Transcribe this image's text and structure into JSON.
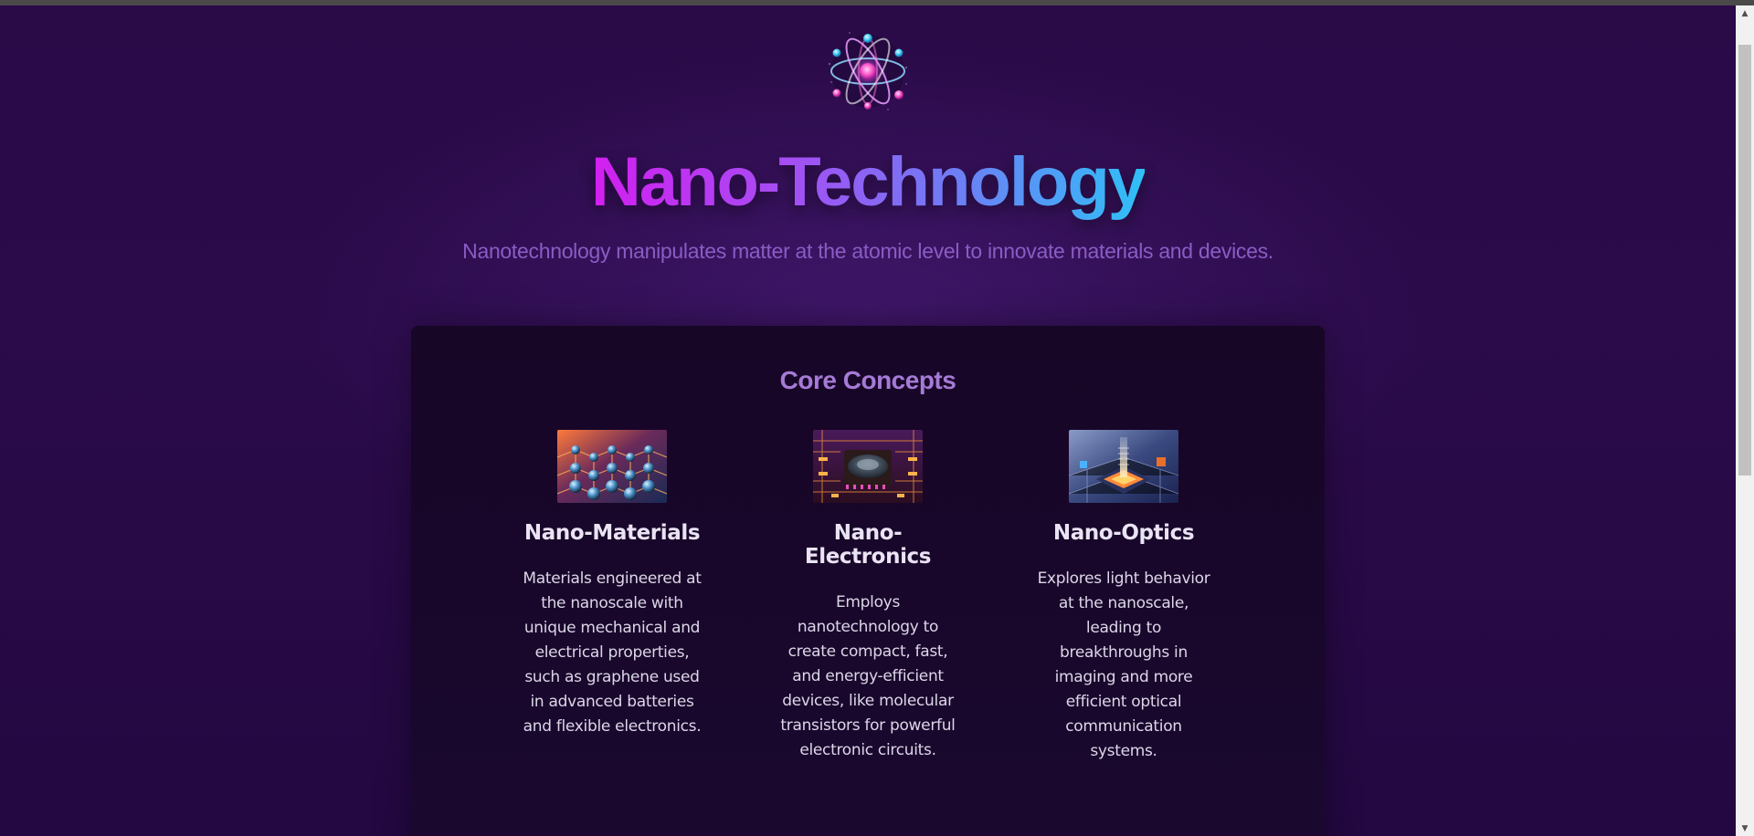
{
  "hero": {
    "title": "Nano-Technology",
    "subtitle": "Nanotechnology manipulates matter at the atomic level to innovate materials and devices."
  },
  "logo": {
    "icon": "atom-icon"
  },
  "core_concepts": {
    "title": "Core Concepts",
    "items": [
      {
        "title": "Nano-Materials",
        "image": "nano-materials-image",
        "text": "Materials engineered at the nanoscale with unique mechanical and electrical properties, such as graphene used in advanced batteries and flexible electronics."
      },
      {
        "title": "Nano-Electronics",
        "image": "nano-electronics-image",
        "text": "Employs nanotechnology to create compact, fast, and energy-efficient devices, like molecular transistors for powerful electronic circuits."
      },
      {
        "title": "Nano-Optics",
        "image": "nano-optics-image",
        "text": "Explores light behavior at the nanoscale, leading to breakthroughs in imaging and more efficient optical communication systems."
      }
    ]
  },
  "colors": {
    "background": "#2a0a47",
    "card": "#170626",
    "title_gradient_start": "#d21ff0",
    "title_gradient_end": "#2fc0f7",
    "subtitle": "#8a5cc4",
    "section_title": "#a67ad6"
  },
  "scrollbar": {
    "up_icon": "arrow-up-icon",
    "down_icon": "arrow-down-icon"
  }
}
